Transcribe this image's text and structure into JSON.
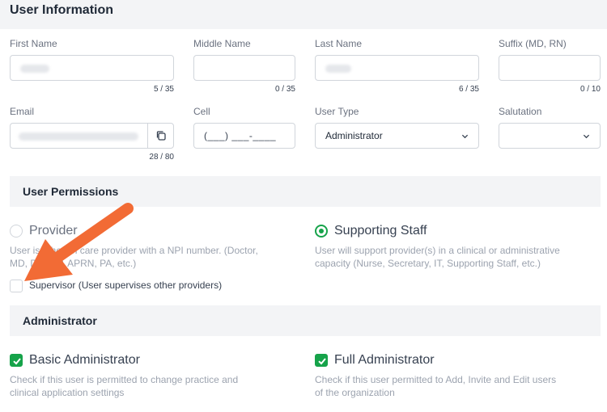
{
  "section": {
    "title": "User Information"
  },
  "fields": {
    "first_name": {
      "label": "First Name",
      "counter": "5 / 35"
    },
    "middle_name": {
      "label": "Middle Name",
      "counter": "0 / 35"
    },
    "last_name": {
      "label": "Last Name",
      "counter": "6 / 35"
    },
    "suffix": {
      "label": "Suffix (MD, RN)",
      "counter": "0 / 10"
    },
    "email": {
      "label": "Email",
      "counter": "28 / 80"
    },
    "cell": {
      "label": "Cell",
      "mask": "(___) ___-____"
    },
    "user_type": {
      "label": "User Type",
      "value": "Administrator"
    },
    "salutation": {
      "label": "Salutation",
      "value": ""
    }
  },
  "permissions": {
    "title": "User Permissions",
    "provider": {
      "label": "Provider",
      "desc_line1": "User is a health care provider with a NPI number. (Doctor,",
      "desc_line2": "MD, DO, NP, APRN, PA, etc.)",
      "selected": false
    },
    "supporting_staff": {
      "label": "Supporting Staff",
      "desc_line1": "User will support provider(s) in a clinical or administrative",
      "desc_line2": "capacity (Nurse, Secretary, IT, Supporting Staff, etc.)",
      "selected": true
    },
    "supervisor": {
      "label": "Supervisor (User supervises other providers)",
      "checked": false
    }
  },
  "administrator": {
    "title": "Administrator",
    "basic": {
      "label": "Basic Administrator",
      "desc_line1": "Check if this user is permitted to change practice and",
      "desc_line2": "clinical application settings",
      "checked": true
    },
    "full": {
      "label": "Full Administrator",
      "desc_line1": "Check if this user permitted to Add, Invite and Edit users",
      "desc_line2": "of the organization",
      "checked": true
    }
  },
  "colors": {
    "accent": "#16a34a",
    "arrow": "#f26b35",
    "band": "#f3f4f6"
  },
  "icons": {
    "copy": "copy-icon",
    "chevron": "chevron-down-icon",
    "check": "check-icon",
    "arrow": "annotation-arrow"
  }
}
